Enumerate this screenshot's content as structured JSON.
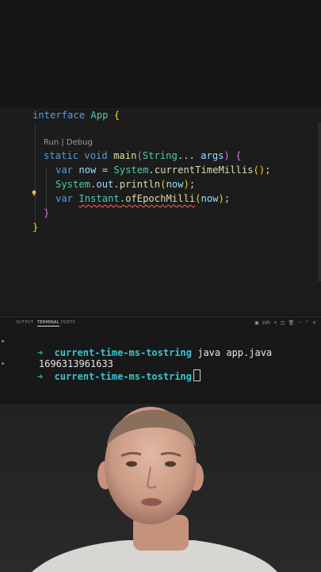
{
  "editor": {
    "lines": [
      {
        "id": "l1",
        "tokens": [
          {
            "c": "kw",
            "t": "interface"
          },
          {
            "c": "pl",
            "t": " "
          },
          {
            "c": "ty",
            "t": "App"
          },
          {
            "c": "pl",
            "t": " "
          },
          {
            "c": "br",
            "t": "{"
          }
        ]
      },
      {
        "id": "l3",
        "tokens": [
          {
            "c": "kw",
            "t": "static"
          },
          {
            "c": "pl",
            "t": " "
          },
          {
            "c": "kw",
            "t": "void"
          },
          {
            "c": "pl",
            "t": " "
          },
          {
            "c": "fn",
            "t": "main"
          },
          {
            "c": "br2",
            "t": "("
          },
          {
            "c": "ty",
            "t": "String"
          },
          {
            "c": "pl",
            "t": "... "
          },
          {
            "c": "id",
            "t": "args"
          },
          {
            "c": "br2",
            "t": ")"
          },
          {
            "c": "pl",
            "t": " "
          },
          {
            "c": "br2",
            "t": "{"
          }
        ]
      },
      {
        "id": "l4",
        "tokens": [
          {
            "c": "kw",
            "t": "var"
          },
          {
            "c": "pl",
            "t": " "
          },
          {
            "c": "id",
            "t": "now"
          },
          {
            "c": "pl",
            "t": " = "
          },
          {
            "c": "ty",
            "t": "System"
          },
          {
            "c": "pl",
            "t": "."
          },
          {
            "c": "fn",
            "t": "currentTimeMillis"
          },
          {
            "c": "br",
            "t": "()"
          },
          {
            "c": "pl",
            "t": ";"
          }
        ]
      },
      {
        "id": "l5",
        "tokens": [
          {
            "c": "ty",
            "t": "System"
          },
          {
            "c": "pl",
            "t": "."
          },
          {
            "c": "id",
            "t": "out"
          },
          {
            "c": "pl",
            "t": "."
          },
          {
            "c": "fn",
            "t": "println"
          },
          {
            "c": "br",
            "t": "("
          },
          {
            "c": "id",
            "t": "now"
          },
          {
            "c": "br",
            "t": ")"
          },
          {
            "c": "pl",
            "t": ";"
          }
        ]
      },
      {
        "id": "l6",
        "tokens": [
          {
            "c": "kw",
            "t": "var"
          },
          {
            "c": "pl",
            "t": " "
          },
          {
            "c": "ty err",
            "t": "Instant"
          },
          {
            "c": "pl err",
            "t": "."
          },
          {
            "c": "fn err",
            "t": "ofEpochMilli"
          },
          {
            "c": "br",
            "t": "("
          },
          {
            "c": "id",
            "t": "now"
          },
          {
            "c": "br",
            "t": ")"
          },
          {
            "c": "pl",
            "t": ";"
          }
        ]
      },
      {
        "id": "l7",
        "tokens": [
          {
            "c": "br2",
            "t": "}"
          }
        ]
      },
      {
        "id": "l8",
        "tokens": [
          {
            "c": "br",
            "t": "}"
          }
        ]
      }
    ],
    "codelens": {
      "run": "Run",
      "sep": " | ",
      "debug": "Debug"
    }
  },
  "panel": {
    "tabs": [
      "OUTPUT",
      "TERMINAL",
      "PORTS"
    ],
    "active_tab": "TERMINAL",
    "tools": {
      "shell": "zsh",
      "plus": "+",
      "more": "···"
    }
  },
  "terminal": {
    "prompt_arrow": "➜",
    "cwd": "current-time-ms-tostring",
    "command": "java app.java",
    "output": "1696313961633"
  },
  "colors": {
    "keyword": "#569cd6",
    "type": "#4ec9b0",
    "function": "#dcdcaa",
    "identifier": "#9cdcfe",
    "bracket_gold": "#ffd700",
    "bracket_pink": "#da70d6",
    "error_underline": "#e05252",
    "prompt_green": "#3fc06a",
    "cwd_cyan": "#39c5cf"
  },
  "icons": [
    "lightbulb-icon",
    "split-terminal-icon",
    "trash-icon",
    "more-icon",
    "close-icon"
  ]
}
